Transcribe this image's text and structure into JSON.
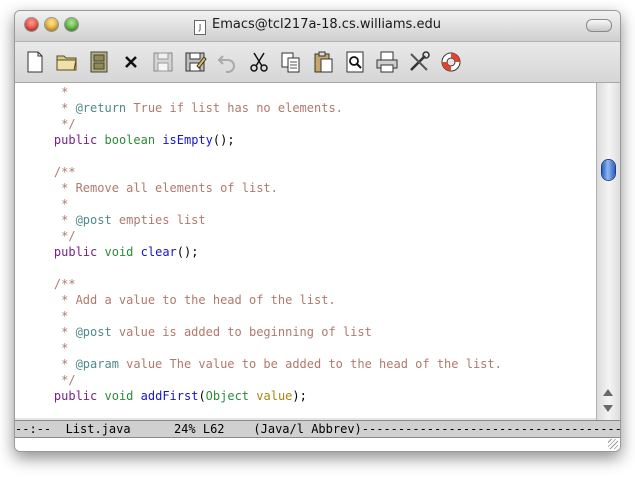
{
  "window": {
    "title": "Emacs@tcl217a-18.cs.williams.edu",
    "doc_icon_glyph": "J"
  },
  "toolbar": {
    "buttons": [
      {
        "name": "new-file",
        "icon": "new-file-icon"
      },
      {
        "name": "open-folder",
        "icon": "folder-icon"
      },
      {
        "name": "open-directory",
        "icon": "file-cabinet-icon"
      },
      {
        "name": "close-buffer",
        "icon": "close-icon",
        "glyph": "×"
      },
      {
        "name": "save",
        "icon": "disk-icon"
      },
      {
        "name": "save-as",
        "icon": "disk-pencil-icon"
      },
      {
        "name": "undo",
        "icon": "undo-icon"
      },
      {
        "name": "cut",
        "icon": "scissors-icon"
      },
      {
        "name": "copy",
        "icon": "copy-icon"
      },
      {
        "name": "paste",
        "icon": "clipboard-icon"
      },
      {
        "name": "search",
        "icon": "search-document-icon"
      },
      {
        "name": "print",
        "icon": "printer-icon"
      },
      {
        "name": "preferences",
        "icon": "tools-icon"
      },
      {
        "name": "help",
        "icon": "lifebuoy-icon"
      }
    ]
  },
  "editor": {
    "lines": [
      [
        {
          "t": "     *",
          "c": "cmt"
        }
      ],
      [
        {
          "t": "     * ",
          "c": "cmt"
        },
        {
          "t": "@return",
          "c": "tag"
        },
        {
          "t": " True if list has no elements.",
          "c": "cmt"
        }
      ],
      [
        {
          "t": "     */",
          "c": "cmt"
        }
      ],
      [
        {
          "t": "    ",
          "c": ""
        },
        {
          "t": "public",
          "c": "kw"
        },
        {
          "t": " ",
          "c": ""
        },
        {
          "t": "boolean",
          "c": "ty"
        },
        {
          "t": " ",
          "c": ""
        },
        {
          "t": "isEmpty",
          "c": "fn"
        },
        {
          "t": "();",
          "c": ""
        }
      ],
      [
        {
          "t": "",
          "c": ""
        }
      ],
      [
        {
          "t": "    /**",
          "c": "cmt"
        }
      ],
      [
        {
          "t": "     * Remove all elements of list.",
          "c": "cmt"
        }
      ],
      [
        {
          "t": "     *",
          "c": "cmt"
        }
      ],
      [
        {
          "t": "     * ",
          "c": "cmt"
        },
        {
          "t": "@post",
          "c": "tag"
        },
        {
          "t": " empties list",
          "c": "cmt"
        }
      ],
      [
        {
          "t": "     */",
          "c": "cmt"
        }
      ],
      [
        {
          "t": "    ",
          "c": ""
        },
        {
          "t": "public",
          "c": "kw"
        },
        {
          "t": " ",
          "c": ""
        },
        {
          "t": "void",
          "c": "ty"
        },
        {
          "t": " ",
          "c": ""
        },
        {
          "t": "clear",
          "c": "fn"
        },
        {
          "t": "();",
          "c": ""
        }
      ],
      [
        {
          "t": "",
          "c": ""
        }
      ],
      [
        {
          "t": "    /**",
          "c": "cmt"
        }
      ],
      [
        {
          "t": "     * Add a value to the head of the list.",
          "c": "cmt"
        }
      ],
      [
        {
          "t": "     *",
          "c": "cmt"
        }
      ],
      [
        {
          "t": "     * ",
          "c": "cmt"
        },
        {
          "t": "@post",
          "c": "tag"
        },
        {
          "t": " value is added to beginning of list",
          "c": "cmt"
        }
      ],
      [
        {
          "t": "     *",
          "c": "cmt"
        }
      ],
      [
        {
          "t": "     * ",
          "c": "cmt"
        },
        {
          "t": "@param",
          "c": "tag"
        },
        {
          "t": " value The value to be added to the head of the list.",
          "c": "cmt"
        }
      ],
      [
        {
          "t": "     */",
          "c": "cmt"
        }
      ],
      [
        {
          "t": "    ",
          "c": ""
        },
        {
          "t": "public",
          "c": "kw"
        },
        {
          "t": " ",
          "c": ""
        },
        {
          "t": "void",
          "c": "ty"
        },
        {
          "t": " ",
          "c": ""
        },
        {
          "t": "addFirst",
          "c": "fn"
        },
        {
          "t": "(",
          "c": ""
        },
        {
          "t": "Object",
          "c": "ty"
        },
        {
          "t": " ",
          "c": ""
        },
        {
          "t": "value",
          "c": "vr"
        },
        {
          "t": ");",
          "c": ""
        }
      ]
    ]
  },
  "modeline": {
    "text": "--:--  List.java      24% L62    (Java/l Abbrev)------------------------------------------"
  },
  "colors": {
    "comment": "#b07a6e",
    "doc_tag": "#4e8a8a",
    "keyword": "#7a1f8c",
    "type": "#2e8b3a",
    "function": "#1515c8",
    "variable": "#a8860f"
  }
}
